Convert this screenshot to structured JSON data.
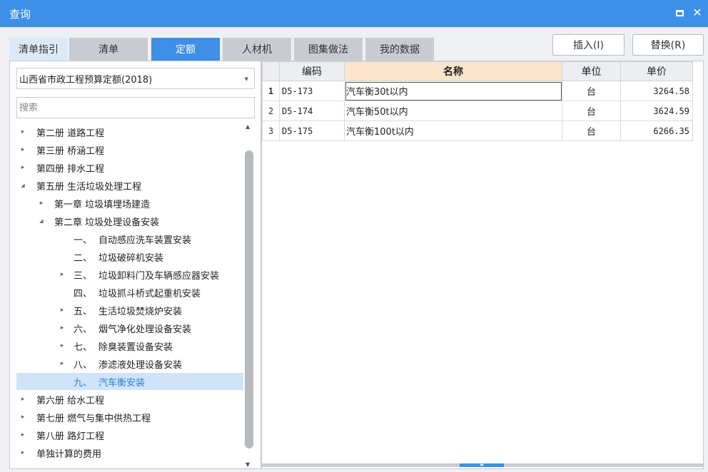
{
  "window": {
    "title": "查询",
    "max_icon": "maximize-icon",
    "close_glyph": "✕"
  },
  "tabs": [
    {
      "label": "清单指引"
    },
    {
      "label": "清单"
    },
    {
      "label": "定额"
    },
    {
      "label": "人材机"
    },
    {
      "label": "图集做法"
    },
    {
      "label": "我的数据"
    }
  ],
  "actions": {
    "insert_label": "插入(I)",
    "replace_label": "替换(R)"
  },
  "quota_select": {
    "value": "山西省市政工程预算定额(2018)"
  },
  "search": {
    "placeholder": "搜索",
    "value": ""
  },
  "tree": [
    {
      "label": "第二册 道路工程",
      "expander": "▸"
    },
    {
      "label": "第三册 桥涵工程",
      "expander": "▸"
    },
    {
      "label": "第四册 排水工程",
      "expander": "▸"
    },
    {
      "label": "第五册 生活垃圾处理工程",
      "expander": "◢"
    },
    {
      "label": "第一章 垃圾填埋场建造",
      "expander": "▸"
    },
    {
      "label": "第二章 垃圾处理设备安装",
      "expander": "◢"
    },
    {
      "num": "一、",
      "label": "自动感应洗车装置安装",
      "expander": ""
    },
    {
      "num": "二、",
      "label": "垃圾破碎机安装",
      "expander": ""
    },
    {
      "num": "三、",
      "label": "垃圾卸料门及车辆感应器安装",
      "expander": "▸"
    },
    {
      "num": "四、",
      "label": "垃圾抓斗桥式起重机安装",
      "expander": ""
    },
    {
      "num": "五、",
      "label": "生活垃圾焚烧炉安装",
      "expander": "▸"
    },
    {
      "num": "六、",
      "label": "烟气净化处理设备安装",
      "expander": "▸"
    },
    {
      "num": "七、",
      "label": "除臭装置设备安装",
      "expander": "▸"
    },
    {
      "num": "八、",
      "label": "渗滤液处理设备安装",
      "expander": "▸"
    },
    {
      "num": "九、",
      "label": "汽车衡安装",
      "expander": ""
    },
    {
      "label": "第六册 给水工程",
      "expander": "▸"
    },
    {
      "label": "第七册 燃气与集中供热工程",
      "expander": "▸"
    },
    {
      "label": "第八册 路灯工程",
      "expander": "▸"
    },
    {
      "label": "单独计算的费用",
      "expander": "▸"
    }
  ],
  "scrollbar": {
    "up": "▲",
    "down": "▼"
  },
  "grid": {
    "headers": {
      "code": "编码",
      "name": "名称",
      "unit": "单位",
      "price": "单价"
    },
    "rows": [
      {
        "no": "1",
        "code": "D5-173",
        "name": "汽车衡30t以内",
        "unit": "台",
        "price": "3264.58"
      },
      {
        "no": "2",
        "code": "D5-174",
        "name": "汽车衡50t以内",
        "unit": "台",
        "price": "3624.59"
      },
      {
        "no": "3",
        "code": "D5-175",
        "name": "汽车衡100t以内",
        "unit": "台",
        "price": "6266.35"
      }
    ]
  }
}
